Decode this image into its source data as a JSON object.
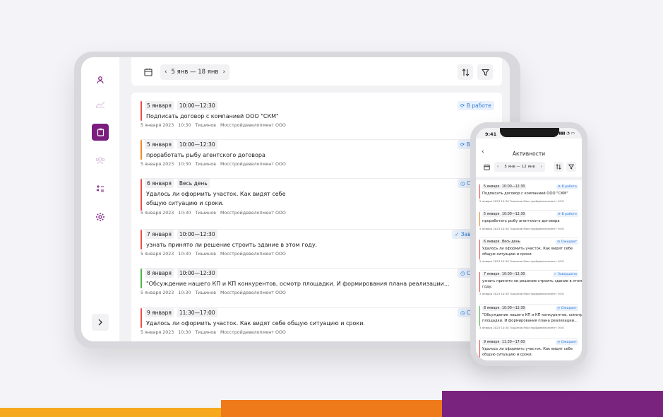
{
  "tablet": {
    "date_range": "5 янв  — 18 янв",
    "rows": [
      {
        "date": "5 января",
        "time": "10:00—12:30",
        "title": "Подписать договор с компанией ООО \"СКМ\"",
        "title2": "",
        "meta_date": "5 января 2023",
        "meta_time": "10:30",
        "meta_person": "Тишинов",
        "meta_company": "Мосстройдевелопмент ООО",
        "status": "В работе",
        "color": "#ef4b4b"
      },
      {
        "date": "5 января",
        "time": "10:00—12:30",
        "title": "проработать рыбу агентского договора",
        "title2": "",
        "meta_date": "5 января 2023",
        "meta_time": "10:30",
        "meta_person": "Тишинов",
        "meta_company": "Мосстройдевелопмент ООО",
        "status": "В",
        "color": "#f08a24"
      },
      {
        "date": "6 января",
        "time": "Весь день",
        "title": "Удалось ли оформить участок. Как видят себе",
        "title2": "общую ситуацию и сроки.",
        "meta_date": "5 января 2023",
        "meta_time": "10:30",
        "meta_person": "Тишинов",
        "meta_company": "Мосстройдевелопмент ООО",
        "status": "С",
        "color": "#ef4b4b"
      },
      {
        "date": "7 января",
        "time": "10:00—12:30",
        "title": "узнать принято ли решение строить здание в этом году.",
        "title2": "",
        "meta_date": "5 января 2023",
        "meta_time": "10:30",
        "meta_person": "Тишинов",
        "meta_company": "Мосстройдевелопмент ООО",
        "status": "Зав",
        "color": "#ef4b4b"
      },
      {
        "date": "8 января",
        "time": "10:00—12:30",
        "title": "\"Обсуждение нашего КП и КП конкурентов, осмотр площадки. И формирования плана реализации...",
        "title2": "",
        "meta_date": "5 января 2023",
        "meta_time": "10:30",
        "meta_person": "Тишинов",
        "meta_company": "Мосстройдевелопмент ООО",
        "status": "С",
        "color": "#4fb548"
      },
      {
        "date": "9 января",
        "time": "11:30—17:00",
        "title": "Удалось ли оформить участок. Как видят себе общую ситуацию и сроки.",
        "title2": "",
        "meta_date": "5 января 2023",
        "meta_time": "10:30",
        "meta_person": "Тишинов",
        "meta_company": "Мосстройдевелопмент ООО",
        "status": "С",
        "color": "#ef4b4b"
      }
    ]
  },
  "phone": {
    "clock": "9:41",
    "title": "Активности",
    "date_range": "5 янв  — 12 янв",
    "rows": [
      {
        "date": "5 января",
        "time": "10:00—12:30",
        "l1": "Подписать договор с компанией ООО \"СКМ\"",
        "l2": "",
        "meta": "5 января 2023  10:30   Тишинов   Мосстройдевелопмент ООО",
        "status": "В работе",
        "color": "#ef4b4b"
      },
      {
        "date": "5 января",
        "time": "10:00—12:30",
        "l1": "проработать рыбу агентского договора",
        "l2": "",
        "meta": "5 января 2023  10:30   Тишинов   Мосстройдевелопмент ООО",
        "status": "В работе",
        "color": "#f08a24"
      },
      {
        "date": "6 января",
        "time": "Весь день",
        "l1": "Удалось ли оформить участок. Как видят себе",
        "l2": "общую ситуацию и сроки.",
        "meta": "5 января 2023  10:30   Тишинов   Мосстройдевелопмент ООО",
        "status": "Ожидает",
        "color": "#ef4b4b"
      },
      {
        "date": "7 января",
        "time": "10:00—12:30",
        "l1": "узнать принято ли решение строить здание в этом",
        "l2": "году.",
        "meta": "5 января 2023  10:30   Тишинов   Мосстройдевелопмент ООО",
        "status": "Завершена",
        "color": "#ef4b4b"
      },
      {
        "date": "8 января",
        "time": "10:00—12:30",
        "l1": "\"Обсуждение нашего КП и КП конкурентов, осмотр",
        "l2": "площадки. И формирования плана реализации...",
        "meta": "5 января 2023  10:30   Тишинов   Мосстройдевелопмент ООО",
        "status": "Ожидает",
        "color": "#4fb548"
      },
      {
        "date": "9 января",
        "time": "11:30—17:00",
        "l1": "Удалось ли оформить участок. Как видят себе",
        "l2": "общую ситуацию и сроки.",
        "meta": "",
        "status": "Ожидает",
        "color": "#ef4b4b"
      }
    ]
  }
}
